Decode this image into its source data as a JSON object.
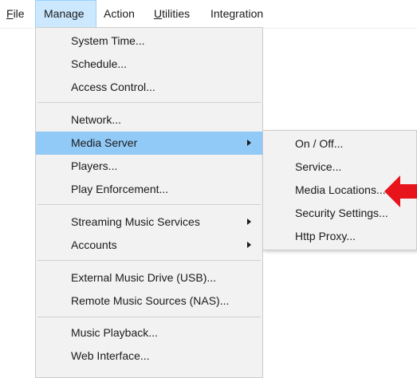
{
  "menubar": {
    "file": {
      "mnemonic": "F",
      "rest": "ile"
    },
    "manage": "Manage",
    "action": "Action",
    "utilities": {
      "mnemonic": "U",
      "rest": "tilities"
    },
    "integration": "Integration"
  },
  "manage_menu": {
    "items": [
      {
        "label": "System Time..."
      },
      {
        "label": "Schedule..."
      },
      {
        "label": "Access Control..."
      },
      {
        "label": "Network..."
      },
      {
        "label": "Media Server"
      },
      {
        "label": "Players..."
      },
      {
        "label": "Play Enforcement..."
      },
      {
        "label": "Streaming Music Services"
      },
      {
        "label": "Accounts"
      },
      {
        "label": "External Music Drive (USB)..."
      },
      {
        "label": "Remote Music Sources (NAS)..."
      },
      {
        "label": "Music Playback..."
      },
      {
        "label": "Web Interface..."
      }
    ]
  },
  "media_server_submenu": {
    "items": [
      {
        "label": "On / Off..."
      },
      {
        "label": "Service..."
      },
      {
        "label": "Media Locations..."
      },
      {
        "label": "Security Settings..."
      },
      {
        "label": "Http Proxy..."
      }
    ]
  },
  "colors": {
    "menu_background": "#f2f2f2",
    "highlight": "#91c9f7",
    "menubar_active": "#cce8ff",
    "annotation_arrow": "#e8141c"
  },
  "icons": [
    "submenu-arrow-icon",
    "red-pointer-arrow-icon"
  ]
}
